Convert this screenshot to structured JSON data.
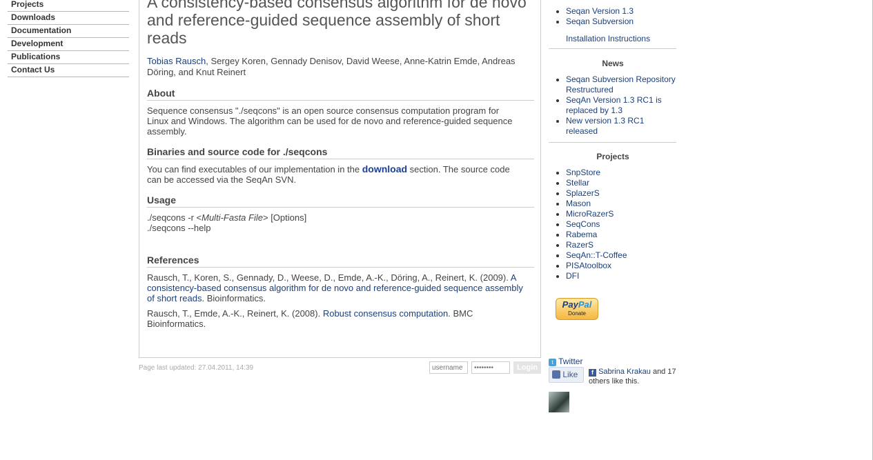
{
  "nav": {
    "items": [
      "Projects",
      "Downloads",
      "Documentation",
      "Development",
      "Publications",
      "Contact Us"
    ]
  },
  "article": {
    "title": "A consistency-based consensus algorithm for de novo and reference-guided sequence assembly of short reads",
    "author_first": "Tobias Rausch",
    "authors_rest": ", Sergey Koren, Gennady Denisov, David Weese, Anne-Katrin Emde, Andreas Döring, and Knut Reinert",
    "about_heading": "About",
    "about_text": "Sequence consensus \"./seqcons\" is an open source consensus computation program for Linux and Windows. The algorithm can be used for de novo and reference-guided sequence assembly.",
    "binaries_heading": "Binaries and source code for ./seqcons",
    "binaries_pre": "You can find executables of our implementation in the ",
    "binaries_link": "download",
    "binaries_post": " section. The source code can be accessed via the SeqAn SVN.",
    "usage_heading": "Usage",
    "usage_line1_pre": "./seqcons -r <",
    "usage_line1_em": "Multi-Fasta File",
    "usage_line1_post": "> [Options]",
    "usage_line2": "./seqcons --help",
    "references_heading": "References",
    "ref1_pre": "Rausch, T., Koren, S., Gennady, D., Weese, D., Emde, A.-K., Döring, A., Reinert, K. (2009). ",
    "ref1_link": "A consistency-based consensus algorithm for de novo and reference-guided sequence assembly of short reads",
    "ref1_post": ". Bioinformatics.",
    "ref2_pre": "Rausch, T., Emde, A.-K., Reinert, K. (2008). ",
    "ref2_link": "Robust consensus computation",
    "ref2_post": ". BMC Bioinformatics."
  },
  "footer": {
    "updated": "Page last updated: 27.04.2011, 14:39",
    "username_placeholder": "username",
    "password_placeholder": "••••••••",
    "login_label": "Login"
  },
  "sidebar": {
    "downloads": [
      "Seqan Version 1.3",
      "Seqan Subversion"
    ],
    "install_link": "Installation Instructions",
    "news_heading": "News",
    "news": [
      "Seqan Subversion Repository Restructured",
      "SeqAn Version 1.3 RC1 is replaced by 1.3",
      "New version 1.3 RC1 released"
    ],
    "projects_heading": "Projects",
    "projects": [
      "SnpStore",
      "Stellar",
      "SplazerS",
      "Mason",
      "MicroRazerS",
      "SeqCons",
      "Rabema",
      "RazerS",
      "SeqAn::T-Coffee",
      "PISAtoolbox",
      "DFI"
    ],
    "paypal_pay": "Pay",
    "paypal_pal": "Pal",
    "paypal_donate": "Donate",
    "twitter_label": "Twitter",
    "like_label": "Like",
    "fb_name": "Sabrina Krakau",
    "fb_suffix": " and 17 others like this."
  },
  "colors": {
    "link": "#1a3f7a",
    "strong_link": "#1a3f9a",
    "border": "#cccccc"
  }
}
